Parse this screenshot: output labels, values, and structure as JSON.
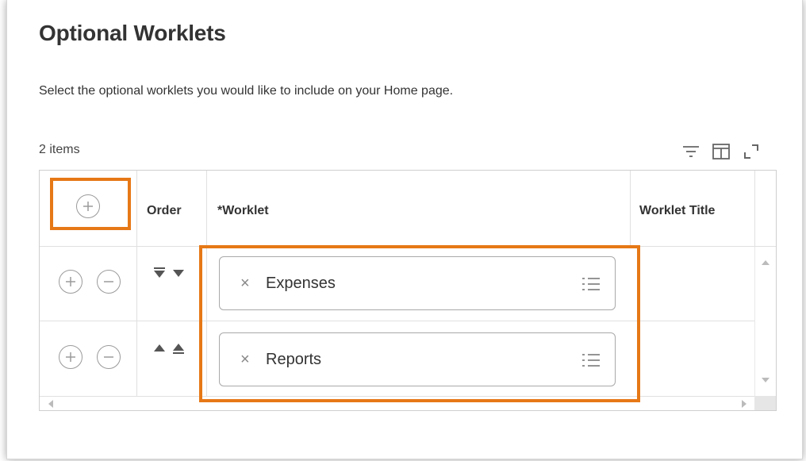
{
  "page": {
    "title": "Optional Worklets",
    "subtitle": "Select the optional worklets you would like to include on your Home page."
  },
  "grid": {
    "count_label": "2 items",
    "toolbar_icons": [
      "filter-icon",
      "columns-icon",
      "expand-icon"
    ],
    "columns": [
      {
        "key": "actions",
        "label": ""
      },
      {
        "key": "order",
        "label": "Order"
      },
      {
        "key": "worklet",
        "label": "*Worklet"
      },
      {
        "key": "worklet_title",
        "label": "Worklet Title"
      }
    ],
    "rows": [
      {
        "worklet": "Expenses",
        "worklet_title": ""
      },
      {
        "worklet": "Reports",
        "worklet_title": ""
      }
    ]
  },
  "colors": {
    "highlight": "#e67816",
    "icon_gray": "#9a9a9a",
    "text": "#333333"
  }
}
